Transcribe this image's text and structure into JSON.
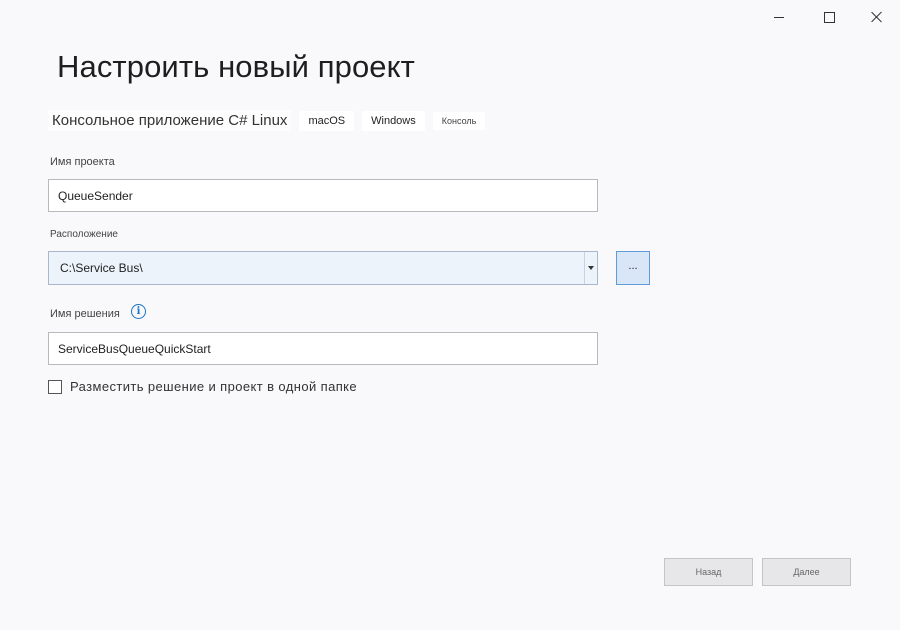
{
  "window": {
    "controls": {
      "minimize_icon": "minimize-icon",
      "maximize_icon": "maximize-icon",
      "close_icon": "close-icon"
    }
  },
  "header": {
    "title": "Настроить новый проект",
    "template_name": "Консольное приложение C# Linux",
    "tags": [
      "macOS",
      "Windows",
      "Консоль"
    ]
  },
  "form": {
    "project_name": {
      "label": "Имя проекта",
      "value": "QueueSender"
    },
    "location": {
      "label": "Расположение",
      "value": "C:\\Service Bus\\",
      "browse_label": "..."
    },
    "solution_name": {
      "label": "Имя решения",
      "info_glyph": "i",
      "value": "ServiceBusQueueQuickStart"
    },
    "same_folder": {
      "label": "Разместить решение и проект в одной папке",
      "checked": false
    }
  },
  "footer": {
    "back_label": "Назад",
    "next_label": "Далее"
  },
  "colors": {
    "accent": "#1a73c8",
    "combo_bg": "#edf3fb",
    "browse_border": "#5e9bd8"
  }
}
